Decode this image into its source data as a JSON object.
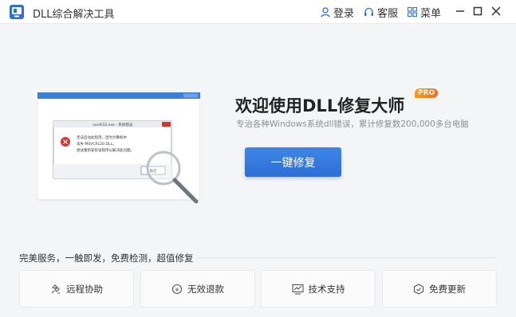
{
  "app": {
    "title": "DLL综合解决工具",
    "logo_icon": "app-logo-icon"
  },
  "nav": {
    "login": {
      "label": "登录",
      "icon": "user-icon"
    },
    "service": {
      "label": "客服",
      "icon": "headset-icon"
    },
    "menu": {
      "label": "菜单",
      "icon": "grid-icon"
    }
  },
  "window_controls": [
    "minimize",
    "maximize",
    "close"
  ],
  "hero": {
    "headline": "欢迎使用DLL修复大师",
    "badge": "PRO",
    "subtitle": "专治各种Windows系统dll错误，累计修复数200,000多台电脑",
    "repair_button": "一键修复"
  },
  "illustration": {
    "dialog_title": "rundll32.exe - 系统错误",
    "dialog_lines": [
      "无法启动此程序，因为计算机中",
      "丢失 MSVCR120.DLL。",
      "尝试重新安装该程序以解决此问题。"
    ],
    "dialog_button": "确定"
  },
  "services": {
    "label": "完美服务，一触即发，免费检测，超值修复",
    "items": [
      {
        "label": "远程协助",
        "icon": "remote-assist-icon"
      },
      {
        "label": "无效退款",
        "icon": "refund-icon"
      },
      {
        "label": "技术支持",
        "icon": "tech-support-icon"
      },
      {
        "label": "免费更新",
        "icon": "update-icon"
      }
    ]
  },
  "colors": {
    "accent": "#2c6fd6",
    "badge": "#f7a11c",
    "error_red": "#d9352f",
    "background": "#f4f5f7"
  }
}
